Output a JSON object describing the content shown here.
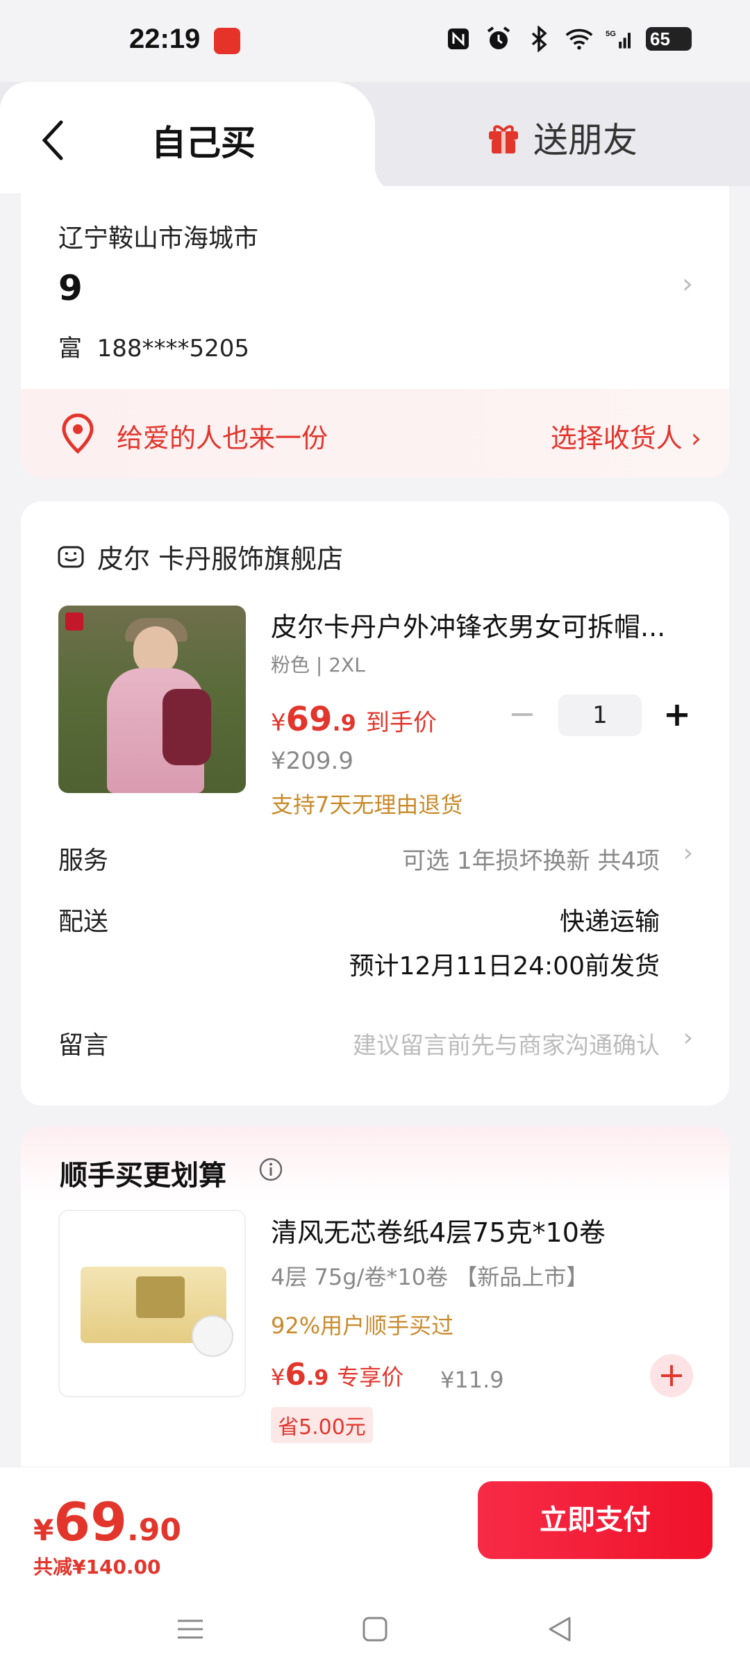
{
  "status_bar": {
    "time": "22:19",
    "battery": "65",
    "network": "5G"
  },
  "tabs": {
    "self_buy": "自己买",
    "send_friend": "送朋友"
  },
  "address": {
    "region": "辽宁鞍山市海城市",
    "detail": "9",
    "name": "富",
    "phone": "188****5205"
  },
  "gift_bar": {
    "text": "给爱的人也来一份",
    "action": "选择收货人 ›"
  },
  "order": {
    "shop_name": "皮尔 卡丹服饰旗舰店",
    "product": {
      "title": "皮尔卡丹户外冲锋衣男女可拆帽...",
      "spec": "粉色 | 2XL",
      "price_yen": "¥",
      "price_int": "69",
      "price_dec": ".9",
      "price_tag": "到手价",
      "original_price": "¥209.9",
      "return_policy": "支持7天无理由退货",
      "quantity": "1"
    },
    "service": {
      "label": "服务",
      "value": "可选 1年损坏换新 共4项"
    },
    "delivery": {
      "label": "配送",
      "method": "快递运输",
      "eta": "预计12月11日24:00前发货"
    },
    "message": {
      "label": "留言",
      "placeholder": "建议留言前先与商家沟通确认"
    }
  },
  "recommend": {
    "title": "顺手买更划算",
    "item": {
      "name": "清风无芯卷纸4层75克*10卷",
      "spec": "4层 75g/卷*10卷 【新品上市】",
      "bought": "92%用户顺手买过",
      "price_yen": "¥",
      "price_int": "6",
      "price_dec": ".9",
      "price_tag": "专享价",
      "original_price": "¥11.9",
      "save": "省5.00元"
    }
  },
  "footer": {
    "total_yen": "¥",
    "total_int": "69",
    "total_dec": ".90",
    "discount": "共减¥140.00",
    "pay_button": "立即支付"
  },
  "colors": {
    "accent": "#e2352c",
    "pay_button": "#f0122a",
    "gold": "#c88a2a"
  }
}
